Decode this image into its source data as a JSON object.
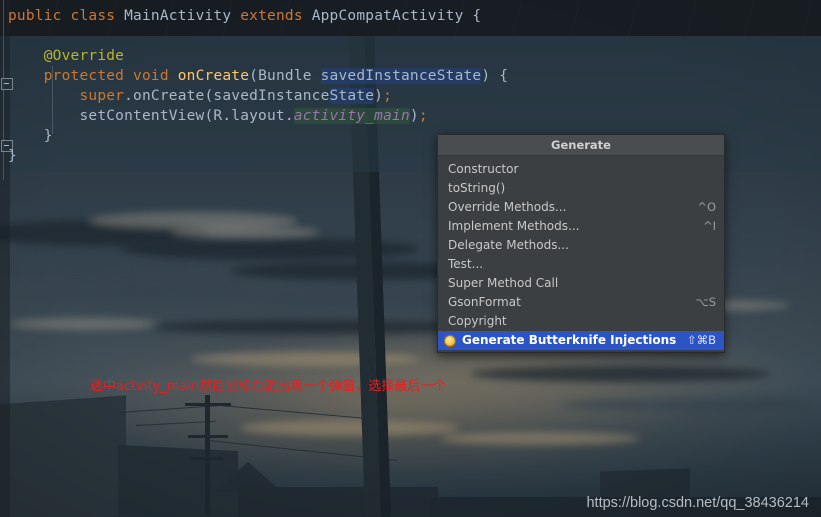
{
  "app": {
    "kind": "android-studio-editor",
    "theme": "darcula-with-wallpaper"
  },
  "editor": {
    "language": "java",
    "lines": [
      {
        "id": "line-class-decl",
        "tokens": [
          {
            "t": "public",
            "k": "kw"
          },
          {
            "t": " ",
            "k": "punct"
          },
          {
            "t": "class",
            "k": "kw"
          },
          {
            "t": " ",
            "k": "punct"
          },
          {
            "t": "MainActivity",
            "k": "ident"
          },
          {
            "t": " ",
            "k": "punct"
          },
          {
            "t": "extends",
            "k": "kw"
          },
          {
            "t": " ",
            "k": "punct"
          },
          {
            "t": "AppCompatActivity",
            "k": "ident"
          },
          {
            "t": " {",
            "k": "punct"
          }
        ]
      },
      {
        "id": "line-blank-1",
        "tokens": [
          {
            "t": "",
            "k": "punct"
          }
        ]
      },
      {
        "id": "line-override-annotation",
        "tokens": [
          {
            "t": "    ",
            "k": "punct"
          },
          {
            "t": "@Override",
            "k": "ann"
          }
        ]
      },
      {
        "id": "line-oncreate-signature",
        "tokens": [
          {
            "t": "    ",
            "k": "punct"
          },
          {
            "t": "protected",
            "k": "kw"
          },
          {
            "t": " ",
            "k": "punct"
          },
          {
            "t": "void",
            "k": "kw"
          },
          {
            "t": " ",
            "k": "punct"
          },
          {
            "t": "onCreate",
            "k": "mth"
          },
          {
            "t": "(",
            "k": "punct"
          },
          {
            "t": "Bundle ",
            "k": "ident"
          },
          {
            "t": "savedInstanceState",
            "k": "sel"
          },
          {
            "t": ") {",
            "k": "punct"
          }
        ]
      },
      {
        "id": "line-super-oncreate",
        "tokens": [
          {
            "t": "        ",
            "k": "punct"
          },
          {
            "t": "super",
            "k": "kw"
          },
          {
            "t": ".onCreate(savedInstance",
            "k": "ident"
          },
          {
            "t": "State",
            "k": "sel"
          },
          {
            "t": ")",
            "k": "punct"
          },
          {
            "t": ";",
            "k": "semi"
          }
        ]
      },
      {
        "id": "line-setcontentview",
        "tokens": [
          {
            "t": "        ",
            "k": "punct"
          },
          {
            "t": "setContentView(R.layout.",
            "k": "ident"
          },
          {
            "t": "activity_main",
            "k": "fieldhl"
          },
          {
            "t": ")",
            "k": "punct"
          },
          {
            "t": ";",
            "k": "semi"
          }
        ]
      },
      {
        "id": "line-close-method",
        "tokens": [
          {
            "t": "    }",
            "k": "punct"
          }
        ]
      },
      {
        "id": "line-close-class",
        "tokens": [
          {
            "t": "}",
            "k": "punct"
          }
        ]
      }
    ]
  },
  "generate_popup": {
    "title": "Generate",
    "items": [
      {
        "label": "Constructor",
        "shortcut": "",
        "icon": "",
        "selected": false
      },
      {
        "label": "toString()",
        "shortcut": "",
        "icon": "",
        "selected": false
      },
      {
        "label": "Override Methods...",
        "shortcut": "^O",
        "icon": "",
        "selected": false
      },
      {
        "label": "Implement Methods...",
        "shortcut": "^I",
        "icon": "",
        "selected": false
      },
      {
        "label": "Delegate Methods...",
        "shortcut": "",
        "icon": "",
        "selected": false
      },
      {
        "label": "Test...",
        "shortcut": "",
        "icon": "",
        "selected": false
      },
      {
        "label": "Super Method Call",
        "shortcut": "",
        "icon": "",
        "selected": false
      },
      {
        "label": "GsonFormat",
        "shortcut": "⌥S",
        "icon": "",
        "selected": false
      },
      {
        "label": "Copyright",
        "shortcut": "",
        "icon": "",
        "selected": false
      },
      {
        "label": "Generate Butterknife Injections",
        "shortcut": "⇧⌘B",
        "icon": "butterknife-dot-icon",
        "selected": true
      }
    ],
    "selection_color": "#2d54c4"
  },
  "annotation": {
    "text": "选中actvity_main然后鼠标右键出现一个弹窗，选择最后一个",
    "color": "#ee1c1c"
  },
  "watermark": {
    "text": "https://blog.csdn.net/qq_38436214"
  },
  "palette": {
    "keyword": "#cc7832",
    "annotation": "#bbb529",
    "method": "#ffc66d",
    "identifier": "#a9b7c6",
    "field_italic": "#9876aa",
    "popup_bg": "#3c3f41",
    "popup_header_bg": "#4a4d4f",
    "selection_blue": "#2d54c4"
  }
}
